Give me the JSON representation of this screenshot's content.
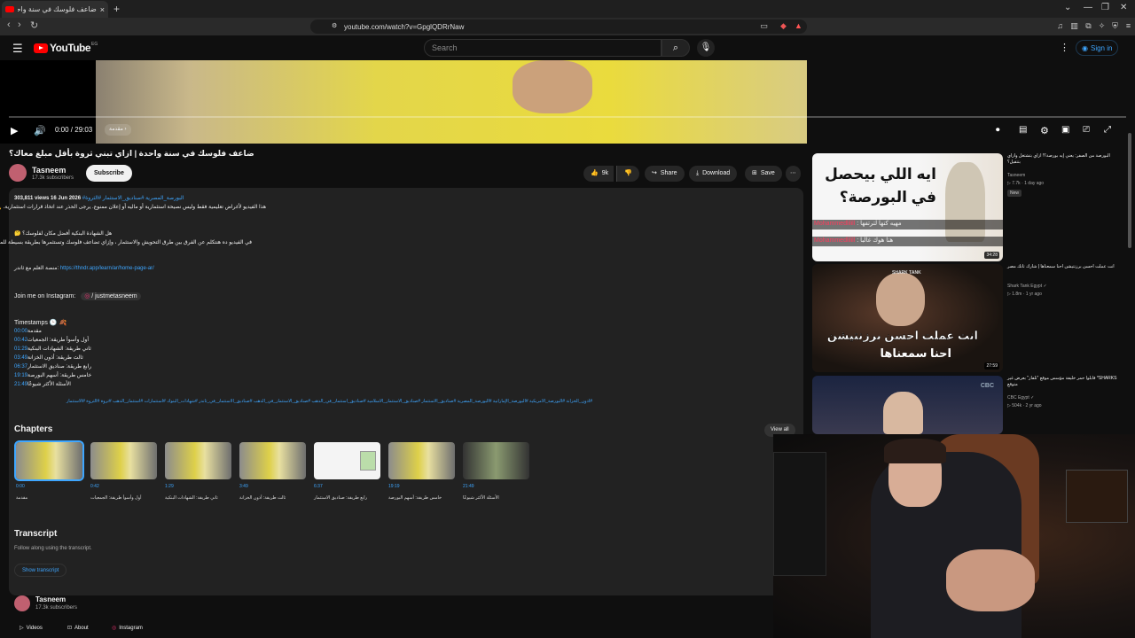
{
  "browser": {
    "tab_title": "ضاعف فلوسك في سنة واحدة | ازا...",
    "tab_close": "×",
    "new_tab": "+",
    "url": "youtube.com/watch?v=GpglQDRrNaw",
    "win_min": "⌄",
    "win_restore": "—",
    "win_max": "❐",
    "win_close": "✕"
  },
  "masthead": {
    "logo_text": "YouTube",
    "logo_country": "EG",
    "search_placeholder": "Search",
    "signin": "Sign in"
  },
  "player": {
    "time": "0:00 / 29:03",
    "chapter_chip": "مقدمة ›"
  },
  "video": {
    "title": "ضاعف فلوسك في سنة واحدة | ازاي تبني ثروة بأقل مبلغ معاك؟",
    "channel": "Tasneem",
    "subscribers": "17.3k subscribers",
    "subscribe": "Subscribe",
    "likes": "9k",
    "share": "Share",
    "download": "Download",
    "save": "Save"
  },
  "description": {
    "meta": "303,811 views  16 Jun 2026",
    "meta_tags": "#البورصة_المصرية #صناديق_الاستثمار #الثروة",
    "line1": "هذا الفيديو لأغراض تعليمية فقط وليس نصيحة استثمارية أو ماليه أو إعلان ممنوع. يرجى الحذر عند اتخاذ قرارات استثمارية. ⚠️",
    "line2": "هل الشهادة البنكية أفضل مكان لفلوسك؟ 🤔",
    "line3": "في الفيديو ده هنتكلم عن الفرق بين طرق التحويش والاستثمار ، وإزاي تضاعف فلوسك وتستثمرها بطريقة بسيطة للمبتدئين.",
    "platform_label": "منصة العلم مع ثاندر:",
    "platform_link": "https://thndr.app/learn/ar/home-page-ar/",
    "instagram_label": "Join me on Instagram:",
    "instagram_handle": "/ justmetasneem",
    "timestamps_label": "Timestamps 🕒 🍂",
    "timestamps": [
      {
        "t": "00:00",
        "label": "مقدمة"
      },
      {
        "t": "00:42",
        "label": "أول وأسوأ طريقة: الجمعيات"
      },
      {
        "t": "01:29",
        "label": "ثاني طريقة: الشهادات البنكية"
      },
      {
        "t": "03:49",
        "label": "ثالث طريقة: أذون الخزانة"
      },
      {
        "t": "06:37",
        "label": "رابع طريقة: صناديق الاستثمار"
      },
      {
        "t": "19:19",
        "label": "خامس طريقة: أسهم البورصة"
      },
      {
        "t": "21:49",
        "label": "الأسئلة الأكثر شيوعًا"
      }
    ],
    "hashtags": "#أذون_الخزانة #البورصة_الأمريكية #البورصة_الإماراتية #البورصة_المصرية #صناديق_الاستثمار #صناديق_الاستثمار_الاسلامية #صناديق_استثمار_في_الذهب #صناديق_الاستثمار_في_الدهب #صناديق_الاستثمار_في_ثاندر #شهادات_البنوك #استثمارات #استثمار_الذهب #ثروة #الثروة #الاستثمار"
  },
  "chapters": {
    "title": "Chapters",
    "view_all": "View all",
    "items": [
      {
        "t": "0:00",
        "label": "مقدمة"
      },
      {
        "t": "0:42",
        "label": "أول وأسوأ طريقة: الجمعيات"
      },
      {
        "t": "1:29",
        "label": "ثاني طريقة: الشهادات البنكية"
      },
      {
        "t": "3:49",
        "label": "ثالث طريقة: أذون الخزانة"
      },
      {
        "t": "6:37",
        "label": "رابع طريقة: صناديق الاستثمار"
      },
      {
        "t": "19:19",
        "label": "خامس طريقة: أسهم البورصة"
      },
      {
        "t": "21:49",
        "label": "الأسئلة الأكثر شيوعًا"
      }
    ]
  },
  "transcript": {
    "title": "Transcript",
    "subtitle": "Follow along using the transcript.",
    "button": "Show transcript"
  },
  "channel_footer": {
    "name": "Tasneem",
    "subs": "17.3k subscribers",
    "videos": "Videos",
    "about": "About",
    "instagram": "Instagram"
  },
  "recommendations": [
    {
      "title": "البورصة من الصفر: يعني إيه بورصة؟! ازاي بتشتغل وازاي بتتقيل؟",
      "channel": "Tasneem",
      "meta": "▷ 7.7k · 1 day ago",
      "badge": "New",
      "duration": "34:28",
      "thumb_text_top": "ايه اللي بيحصل",
      "thumb_text_bottom": "في البورصة؟",
      "chat1_user": "Mohammedlilill",
      "chat1_msg": ": مهيه كنها لترتفها",
      "chat2_user": "Mohammedlilill",
      "chat2_msg": ": هنا هوك غالبا"
    },
    {
      "title": "انت عملت احسن برزنتيشن احنا سمعناها | شارك تانك مصر",
      "channel": "Shark Tank Egypt ✓",
      "meta": "▷ 1.8m · 1 yr ago",
      "duration": "27:59",
      "thumb_text_top": "انت عملت احسن برزنتيشن",
      "thumb_text_bottom": "احنا سمعناها",
      "thumb_logo": "SHARK TANK"
    },
    {
      "title": "SHARKS* قابلوا حمر خليفة مؤسس موقع \"تلفاز\" بعرض غير متوقع",
      "channel": "CBC Egypt ✓",
      "meta": "▷ 504k · 2 yr ago",
      "thumb_logo": "CBC"
    }
  ],
  "colors": {
    "accent_link": "#3ea6ff",
    "brand_red": "#ff0000",
    "bg": "#0f0f0f"
  }
}
